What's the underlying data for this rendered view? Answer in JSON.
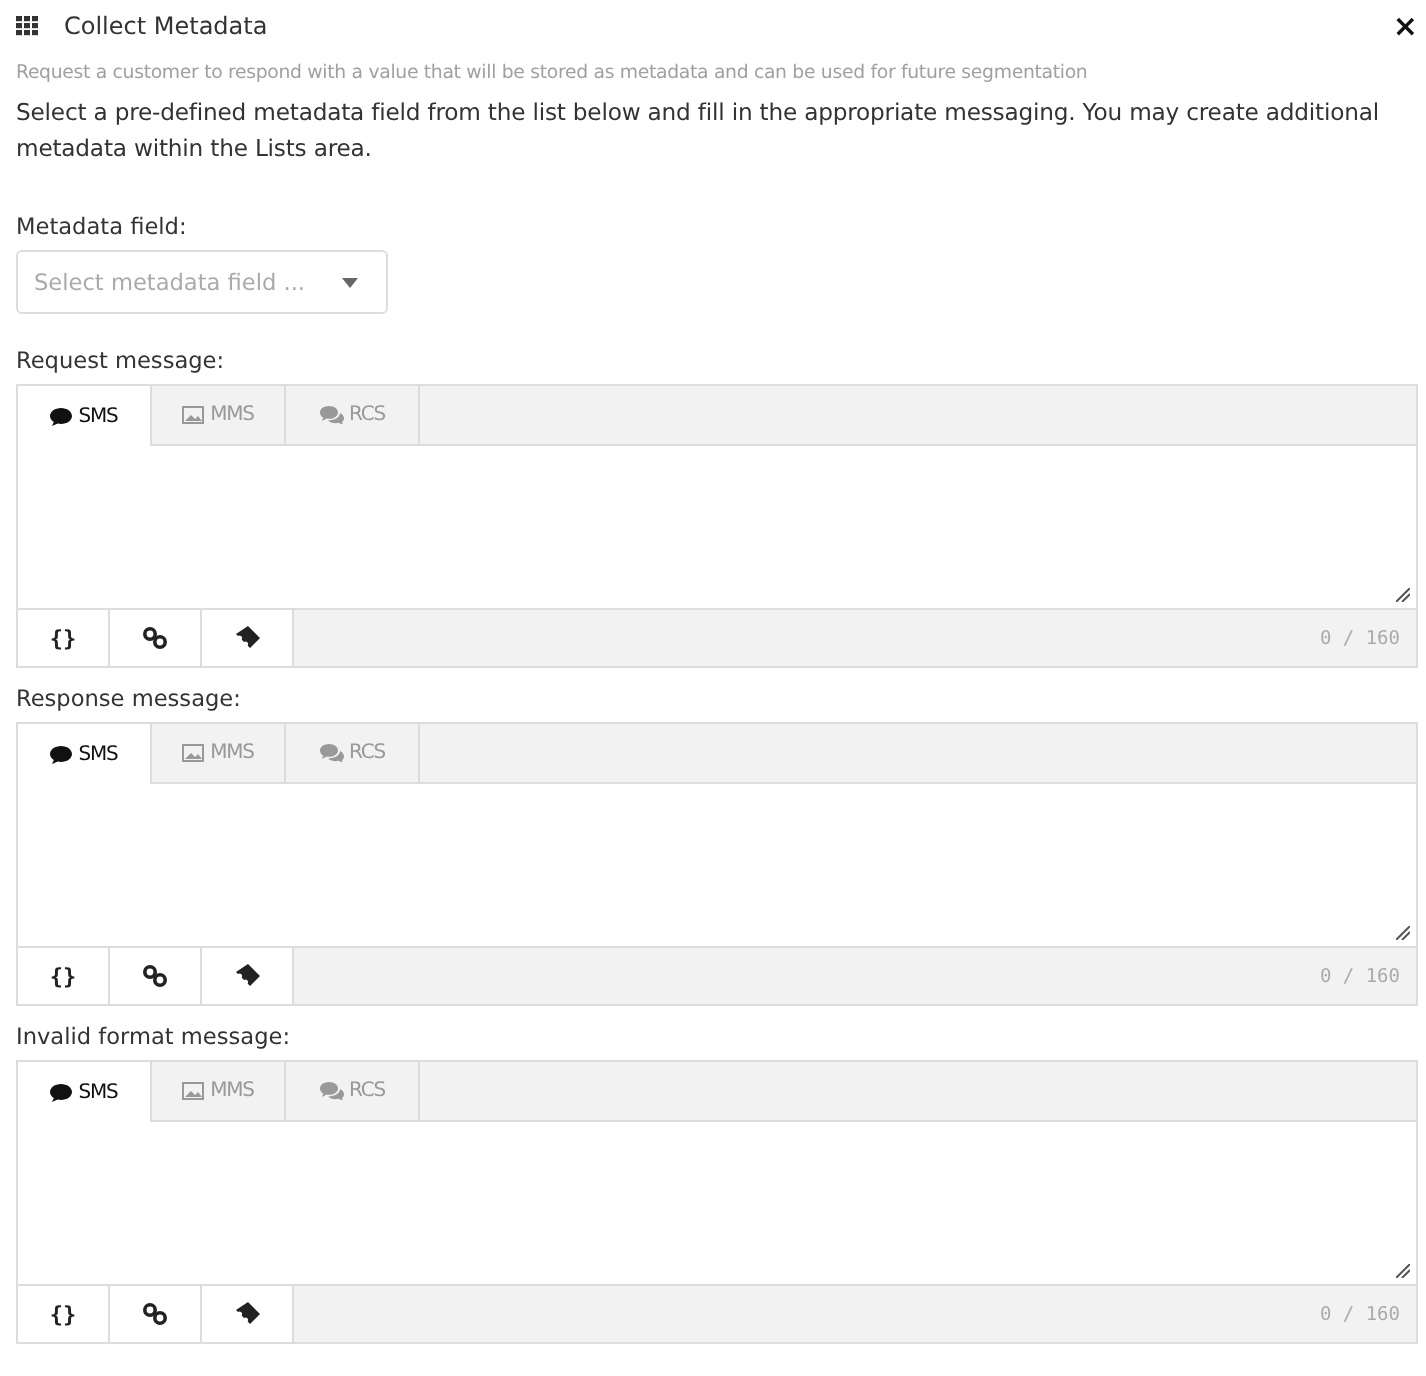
{
  "window": {
    "title": "Collect Metadata",
    "close": "×"
  },
  "subtitle": "Request a customer to respond with a value that will be stored as metadata and can be used for future segmentation",
  "description": "Select a pre-defined metadata field from the list below and fill in the appropriate messaging. You may create additional metadata within the Lists area.",
  "metadata_field": {
    "label": "Metadata field:",
    "placeholder": "Select metadata field ..."
  },
  "messages": [
    {
      "label": "Request message:",
      "tabs": [
        {
          "label": "SMS",
          "selected": true
        },
        {
          "label": "MMS",
          "selected": false
        },
        {
          "label": "RCS",
          "selected": false
        }
      ],
      "variables_button": "{}",
      "counter": "0 / 160"
    },
    {
      "label": "Response message:",
      "tabs": [
        {
          "label": "SMS",
          "selected": true
        },
        {
          "label": "MMS",
          "selected": false
        },
        {
          "label": "RCS",
          "selected": false
        }
      ],
      "variables_button": "{}",
      "counter": "0 / 160"
    },
    {
      "label": "Invalid format message:",
      "tabs": [
        {
          "label": "SMS",
          "selected": true
        },
        {
          "label": "MMS",
          "selected": false
        },
        {
          "label": "RCS",
          "selected": false
        }
      ],
      "variables_button": "{}",
      "counter": "0 / 160"
    }
  ]
}
